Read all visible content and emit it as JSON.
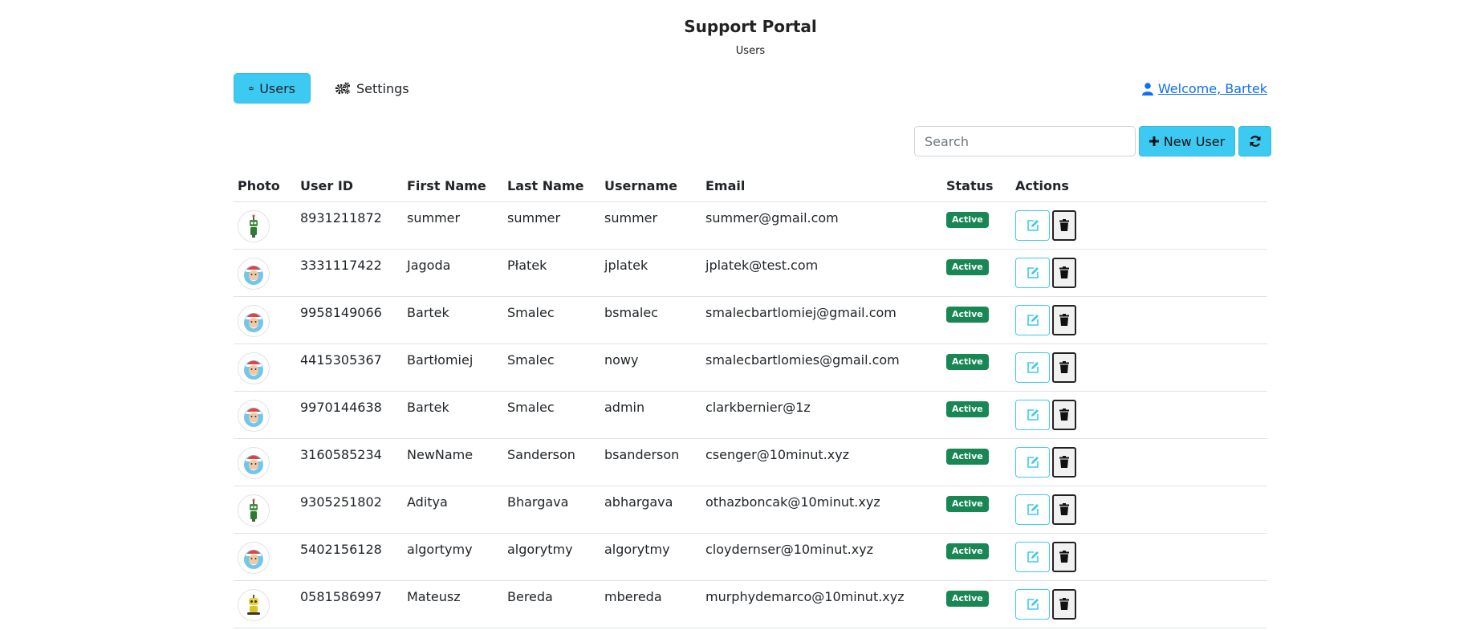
{
  "header": {
    "title": "Support Portal",
    "subtitle": "Users"
  },
  "nav": {
    "tabs": [
      {
        "label": "Users",
        "icon": "users-icon",
        "active": true
      },
      {
        "label": "Settings",
        "icon": "gears-icon",
        "active": false
      }
    ],
    "welcome": "Welcome, Bartek",
    "welcome_icon": "user-icon"
  },
  "toolbar": {
    "search_placeholder": "Search",
    "search_value": "",
    "new_user_label": "New User",
    "new_user_icon": "plus-icon",
    "refresh_icon": "refresh-icon"
  },
  "table": {
    "columns": [
      "Photo",
      "User ID",
      "First Name",
      "Last Name",
      "Username",
      "Email",
      "Status",
      "Actions"
    ],
    "rows": [
      {
        "avatar": "robot-green",
        "user_id": "8931211872",
        "first_name": "summer",
        "last_name": "summer",
        "username": "summer",
        "email": "summer@gmail.com",
        "status": "Active"
      },
      {
        "avatar": "santa",
        "user_id": "3331117422",
        "first_name": "Jagoda",
        "last_name": "Płatek",
        "username": "jplatek",
        "email": "jplatek@test.com",
        "status": "Active"
      },
      {
        "avatar": "santa",
        "user_id": "9958149066",
        "first_name": "Bartek",
        "last_name": "Smalec",
        "username": "bsmalec",
        "email": "smalecbartlomiej@gmail.com",
        "status": "Active"
      },
      {
        "avatar": "santa",
        "user_id": "4415305367",
        "first_name": "Bartłomiej",
        "last_name": "Smalec",
        "username": "nowy",
        "email": "smalecbartlomies@gmail.com",
        "status": "Active"
      },
      {
        "avatar": "santa",
        "user_id": "9970144638",
        "first_name": "Bartek",
        "last_name": "Smalec",
        "username": "admin",
        "email": "clarkbernier@1z",
        "status": "Active"
      },
      {
        "avatar": "santa",
        "user_id": "3160585234",
        "first_name": "NewName",
        "last_name": "Sanderson",
        "username": "bsanderson",
        "email": "csenger@10minut.xyz",
        "status": "Active"
      },
      {
        "avatar": "robot-green",
        "user_id": "9305251802",
        "first_name": "Aditya",
        "last_name": "Bhargava",
        "username": "abhargava",
        "email": "othazboncak@10minut.xyz",
        "status": "Active"
      },
      {
        "avatar": "santa",
        "user_id": "5402156128",
        "first_name": "algortymy",
        "last_name": "algorytmy",
        "username": "algorytmy",
        "email": "cloydernser@10minut.xyz",
        "status": "Active"
      },
      {
        "avatar": "robot-yellow",
        "user_id": "0581586997",
        "first_name": "Mateusz",
        "last_name": "Bereda",
        "username": "mbereda",
        "email": "murphydemarco@10minut.xyz",
        "status": "Active"
      }
    ]
  },
  "colors": {
    "accent": "#3dcaf2",
    "status_active": "#198754",
    "link": "#0d6efd"
  }
}
